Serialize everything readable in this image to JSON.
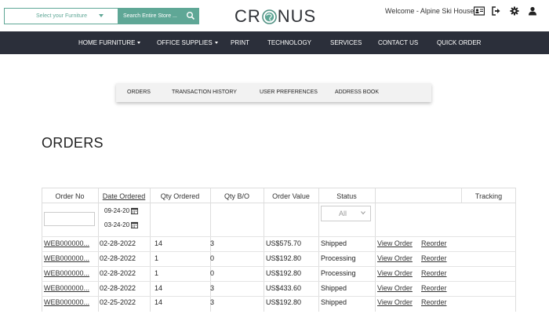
{
  "header": {
    "furniture_select": "Select your Furniture",
    "search_placeholder": "Search Entire Store ...",
    "logo": {
      "prefix": "CR",
      "suffix": "NUS"
    },
    "welcome": "Welcome - Alpine Ski House"
  },
  "nav": [
    {
      "label": "HOME FURNITURE",
      "dropdown": true
    },
    {
      "label": "OFFICE SUPPLIES",
      "dropdown": true
    },
    {
      "label": "PRINT",
      "dropdown": false
    },
    {
      "label": "TECHNOLOGY",
      "dropdown": false
    },
    {
      "label": "SERVICES",
      "dropdown": false
    },
    {
      "label": "CONTACT US",
      "dropdown": false
    },
    {
      "label": "QUICK ORDER",
      "dropdown": false
    }
  ],
  "tabs": [
    "ORDERS",
    "TRANSACTION HISTORY",
    "USER PREFERENCES",
    "ADDRESS BOOK"
  ],
  "page_title": "ORDERS",
  "table": {
    "columns": [
      "Order No",
      "Date Ordered",
      "Qty Ordered",
      "Qty B/O",
      "Order Value",
      "Status",
      "",
      "Tracking"
    ],
    "filters": {
      "order_no": "",
      "date_from": "09-24-20",
      "date_to": "03-24-20",
      "status": "All"
    },
    "rows": [
      {
        "order_no": "WEB000000...",
        "date": "02-28-2022",
        "qty": "14",
        "bo": "3",
        "value": "US$575.70",
        "status": "Shipped",
        "view": "View Order",
        "reorder": "Reorder"
      },
      {
        "order_no": "WEB000000...",
        "date": "02-28-2022",
        "qty": "1",
        "bo": "0",
        "value": "US$192.80",
        "status": "Processing",
        "view": "View Order",
        "reorder": "Reorder"
      },
      {
        "order_no": "WEB000000...",
        "date": "02-28-2022",
        "qty": "1",
        "bo": "0",
        "value": "US$192.80",
        "status": "Processing",
        "view": "View Order",
        "reorder": "Reorder"
      },
      {
        "order_no": "WEB000000...",
        "date": "02-28-2022",
        "qty": "14",
        "bo": "3",
        "value": "US$433.60",
        "status": "Shipped",
        "view": "View Order",
        "reorder": "Reorder"
      },
      {
        "order_no": "WEB000000...",
        "date": "02-25-2022",
        "qty": "14",
        "bo": "3",
        "value": "US$192.80",
        "status": "Shipped",
        "view": "View Order",
        "reorder": "Reorder"
      }
    ]
  },
  "colors": {
    "accent": "#5fa796",
    "navbar": "#2b2f3a"
  },
  "icons": [
    "chevron-down-icon",
    "search-icon",
    "id-card-icon",
    "sign-out-icon",
    "gear-icon",
    "user-icon",
    "calendar-icon"
  ]
}
